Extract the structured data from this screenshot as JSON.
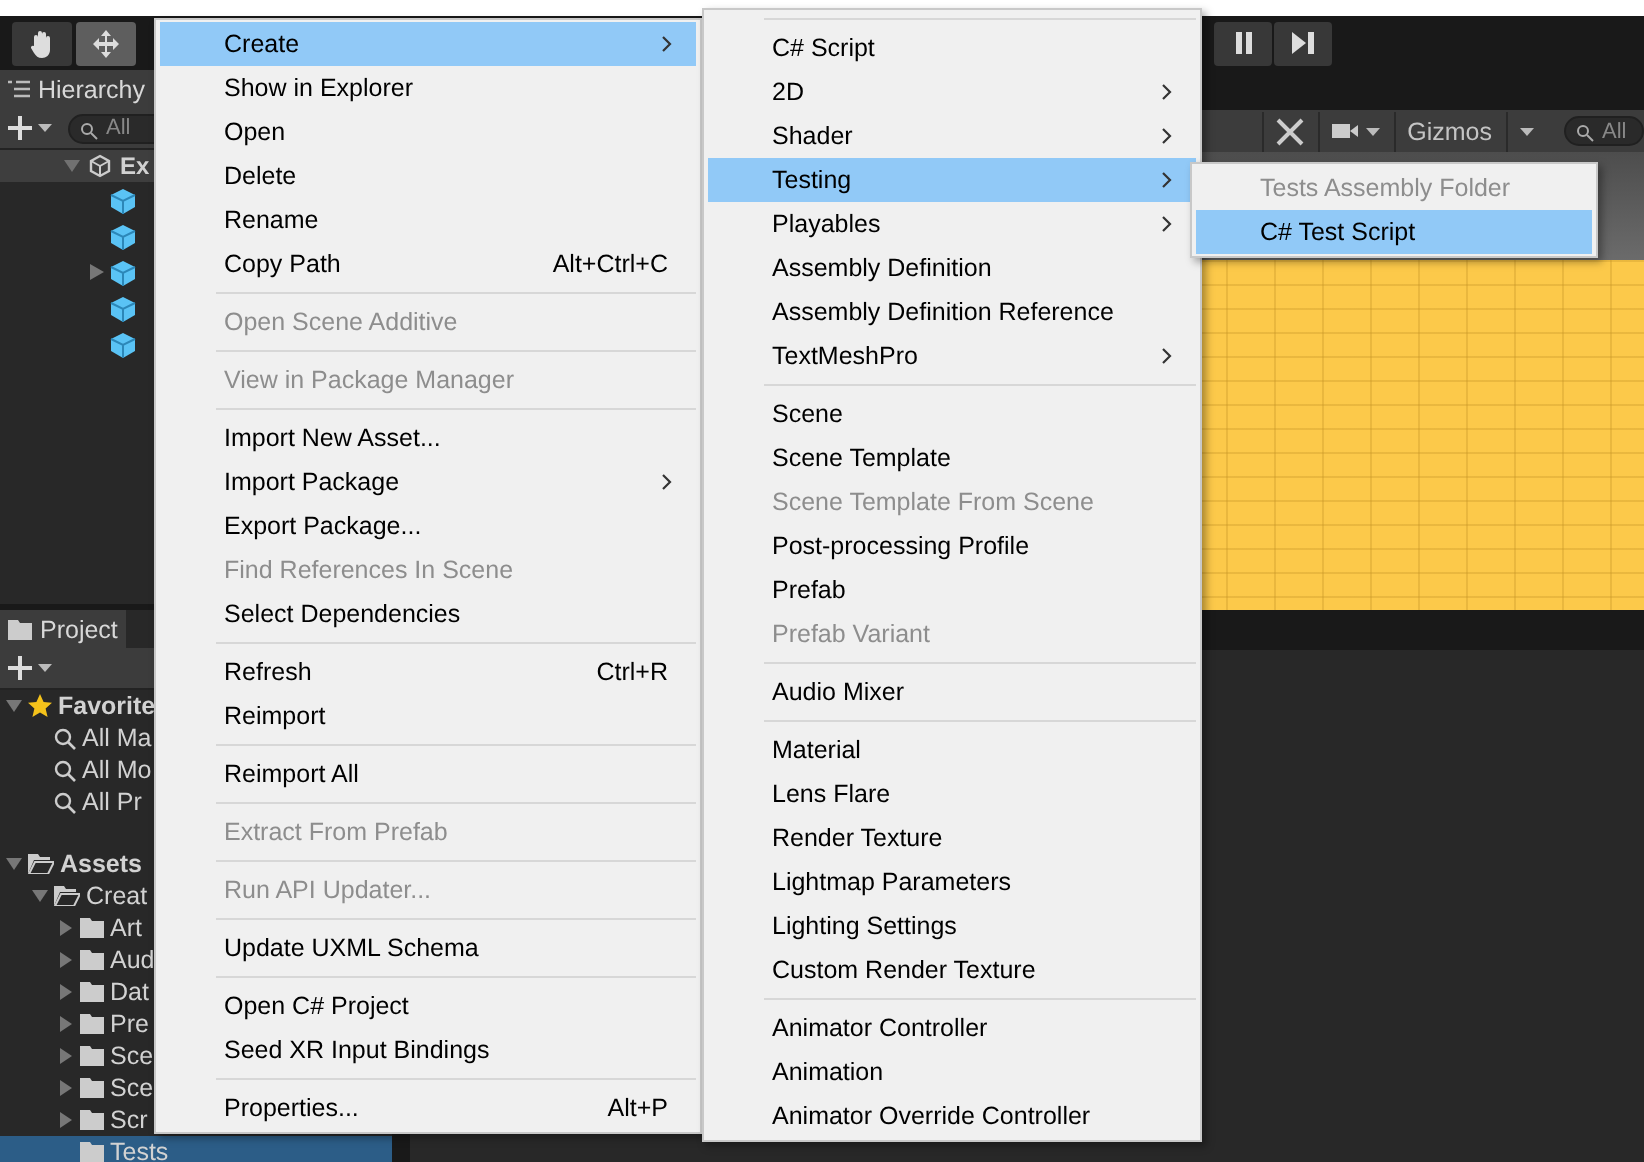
{
  "toolbar": {
    "tools": [
      {
        "kind": "hand",
        "selected": false
      },
      {
        "kind": "move",
        "selected": true
      }
    ],
    "playback": [
      {
        "kind": "pause"
      },
      {
        "kind": "step"
      }
    ]
  },
  "hierarchy": {
    "title": "Hierarchy",
    "search_placeholder": "All",
    "scene": {
      "name": "Ex",
      "expanded": true,
      "children": [
        {
          "expandable": false
        },
        {
          "expandable": false
        },
        {
          "expandable": true
        },
        {
          "expandable": false
        },
        {
          "expandable": false
        }
      ]
    }
  },
  "scene_view": {
    "gizmos": "Gizmos",
    "search_placeholder": "All"
  },
  "project": {
    "title": "Project",
    "tree": [
      {
        "name": "Favorite",
        "kind": "favorites",
        "expanded": true,
        "selected": false,
        "children": [
          {
            "name": "All Ma",
            "kind": "search",
            "selected": false
          },
          {
            "name": "All Mo",
            "kind": "search",
            "selected": false
          },
          {
            "name": "All Pr",
            "kind": "search",
            "selected": false
          }
        ]
      },
      {
        "name": "Assets",
        "kind": "folder",
        "expanded": true,
        "selected": false,
        "children": [
          {
            "name": "Creat",
            "kind": "folder",
            "expanded": true,
            "selected": false,
            "children": [
              {
                "name": "Art",
                "kind": "folder",
                "expanded": false,
                "selected": false
              },
              {
                "name": "Aud",
                "kind": "folder",
                "expanded": false,
                "selected": false
              },
              {
                "name": "Dat",
                "kind": "folder",
                "expanded": false,
                "selected": false
              },
              {
                "name": "Pre",
                "kind": "folder",
                "expanded": false,
                "selected": false
              },
              {
                "name": "Sce",
                "kind": "folder",
                "expanded": false,
                "selected": false
              },
              {
                "name": "Sce",
                "kind": "folder",
                "expanded": false,
                "selected": false
              },
              {
                "name": "Scr",
                "kind": "folder",
                "expanded": false,
                "selected": false
              },
              {
                "name": "Tests",
                "kind": "folder",
                "selected": true
              }
            ]
          }
        ]
      }
    ]
  },
  "context_menu": [
    {
      "kind": "item",
      "label": "Create",
      "submenu": true,
      "disabled": false,
      "selected": true
    },
    {
      "kind": "item",
      "label": "Show in Explorer",
      "disabled": false,
      "selected": false
    },
    {
      "kind": "item",
      "label": "Open",
      "disabled": false,
      "selected": false
    },
    {
      "kind": "item",
      "label": "Delete",
      "disabled": false,
      "selected": false
    },
    {
      "kind": "item",
      "label": "Rename",
      "disabled": false,
      "selected": false
    },
    {
      "kind": "item",
      "label": "Copy Path",
      "shortcut": "Alt+Ctrl+C",
      "disabled": false,
      "selected": false
    },
    {
      "kind": "separator"
    },
    {
      "kind": "item",
      "label": "Open Scene Additive",
      "disabled": true,
      "selected": false
    },
    {
      "kind": "separator"
    },
    {
      "kind": "item",
      "label": "View in Package Manager",
      "disabled": true,
      "selected": false
    },
    {
      "kind": "separator"
    },
    {
      "kind": "item",
      "label": "Import New Asset...",
      "disabled": false,
      "selected": false
    },
    {
      "kind": "item",
      "label": "Import Package",
      "submenu": true,
      "disabled": false,
      "selected": false
    },
    {
      "kind": "item",
      "label": "Export Package...",
      "disabled": false,
      "selected": false
    },
    {
      "kind": "item",
      "label": "Find References In Scene",
      "disabled": true,
      "selected": false
    },
    {
      "kind": "item",
      "label": "Select Dependencies",
      "disabled": false,
      "selected": false
    },
    {
      "kind": "separator"
    },
    {
      "kind": "item",
      "label": "Refresh",
      "shortcut": "Ctrl+R",
      "disabled": false,
      "selected": false
    },
    {
      "kind": "item",
      "label": "Reimport",
      "disabled": false,
      "selected": false
    },
    {
      "kind": "separator"
    },
    {
      "kind": "item",
      "label": "Reimport All",
      "disabled": false,
      "selected": false
    },
    {
      "kind": "separator"
    },
    {
      "kind": "item",
      "label": "Extract From Prefab",
      "disabled": true,
      "selected": false
    },
    {
      "kind": "separator"
    },
    {
      "kind": "item",
      "label": "Run API Updater...",
      "disabled": true,
      "selected": false
    },
    {
      "kind": "separator"
    },
    {
      "kind": "item",
      "label": "Update UXML Schema",
      "disabled": false,
      "selected": false
    },
    {
      "kind": "separator"
    },
    {
      "kind": "item",
      "label": "Open C# Project",
      "disabled": false,
      "selected": false
    },
    {
      "kind": "item",
      "label": "Seed XR Input Bindings",
      "disabled": false,
      "selected": false
    },
    {
      "kind": "separator"
    },
    {
      "kind": "item",
      "label": "Properties...",
      "shortcut": "Alt+P",
      "disabled": false,
      "selected": false
    }
  ],
  "create_submenu": [
    {
      "kind": "separator"
    },
    {
      "kind": "item",
      "label": "C# Script",
      "disabled": false,
      "selected": false
    },
    {
      "kind": "item",
      "label": "2D",
      "submenu": true,
      "disabled": false,
      "selected": false
    },
    {
      "kind": "item",
      "label": "Shader",
      "submenu": true,
      "disabled": false,
      "selected": false
    },
    {
      "kind": "item",
      "label": "Testing",
      "submenu": true,
      "disabled": false,
      "selected": true
    },
    {
      "kind": "item",
      "label": "Playables",
      "submenu": true,
      "disabled": false,
      "selected": false
    },
    {
      "kind": "item",
      "label": "Assembly Definition",
      "disabled": false,
      "selected": false
    },
    {
      "kind": "item",
      "label": "Assembly Definition Reference",
      "disabled": false,
      "selected": false
    },
    {
      "kind": "item",
      "label": "TextMeshPro",
      "submenu": true,
      "disabled": false,
      "selected": false
    },
    {
      "kind": "separator"
    },
    {
      "kind": "item",
      "label": "Scene",
      "disabled": false,
      "selected": false
    },
    {
      "kind": "item",
      "label": "Scene Template",
      "disabled": false,
      "selected": false
    },
    {
      "kind": "item",
      "label": "Scene Template From Scene",
      "disabled": true,
      "selected": false
    },
    {
      "kind": "item",
      "label": "Post-processing Profile",
      "disabled": false,
      "selected": false
    },
    {
      "kind": "item",
      "label": "Prefab",
      "disabled": false,
      "selected": false
    },
    {
      "kind": "item",
      "label": "Prefab Variant",
      "disabled": true,
      "selected": false
    },
    {
      "kind": "separator"
    },
    {
      "kind": "item",
      "label": "Audio Mixer",
      "disabled": false,
      "selected": false
    },
    {
      "kind": "separator"
    },
    {
      "kind": "item",
      "label": "Material",
      "disabled": false,
      "selected": false
    },
    {
      "kind": "item",
      "label": "Lens Flare",
      "disabled": false,
      "selected": false
    },
    {
      "kind": "item",
      "label": "Render Texture",
      "disabled": false,
      "selected": false
    },
    {
      "kind": "item",
      "label": "Lightmap Parameters",
      "disabled": false,
      "selected": false
    },
    {
      "kind": "item",
      "label": "Lighting Settings",
      "disabled": false,
      "selected": false
    },
    {
      "kind": "item",
      "label": "Custom Render Texture",
      "disabled": false,
      "selected": false
    },
    {
      "kind": "separator"
    },
    {
      "kind": "item",
      "label": "Animator Controller",
      "disabled": false,
      "selected": false
    },
    {
      "kind": "item",
      "label": "Animation",
      "disabled": false,
      "selected": false
    },
    {
      "kind": "item",
      "label": "Animator Override Controller",
      "disabled": false,
      "selected": false
    }
  ],
  "testing_submenu": [
    {
      "kind": "item",
      "label": "Tests Assembly Folder",
      "disabled": true,
      "selected": false
    },
    {
      "kind": "item",
      "label": "C# Test Script",
      "disabled": false,
      "selected": true
    }
  ]
}
